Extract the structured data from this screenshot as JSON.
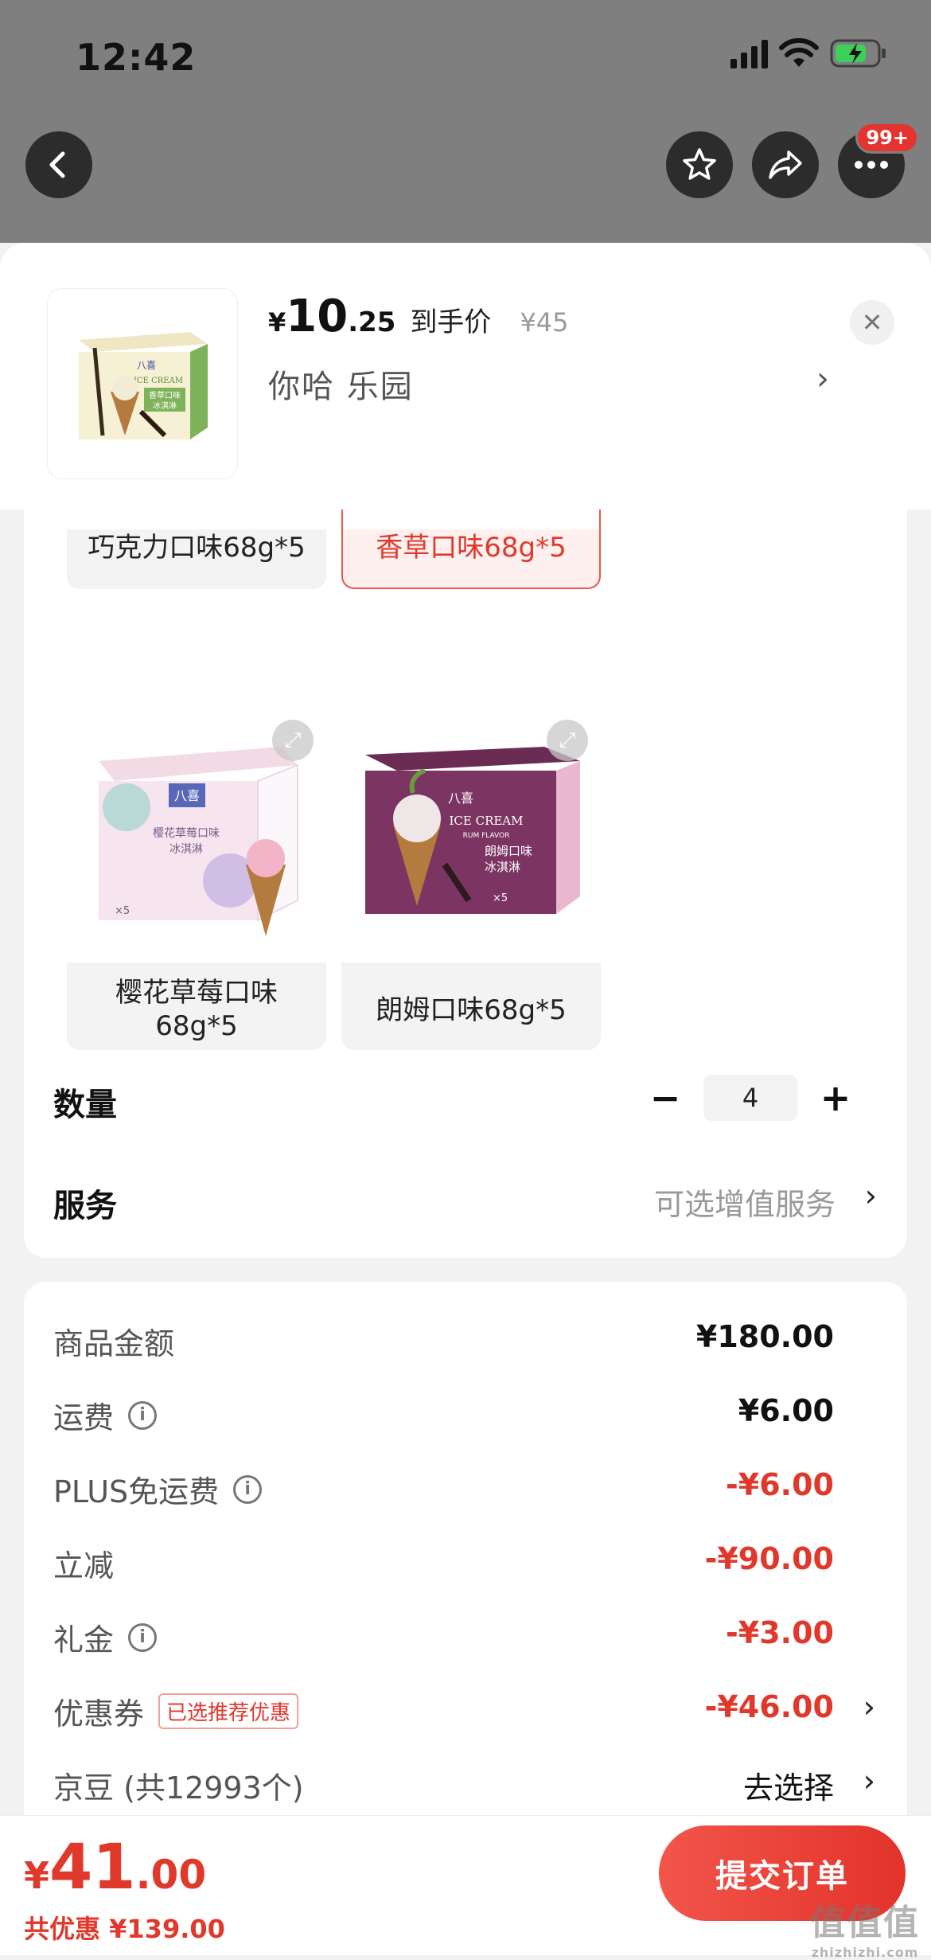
{
  "status_bar": {
    "time": "12:42"
  },
  "nav": {
    "more_badge": "99+"
  },
  "header": {
    "price_symbol": "¥",
    "price_int": "10",
    "price_dec": ".25",
    "price_label": "到手价",
    "original_price": "¥45",
    "selected_spec": "你哈  乐园",
    "spec_chevron": "›",
    "close_symbol": "✕"
  },
  "variants": [
    {
      "label": "巧克力口味68g*5"
    },
    {
      "label": "香草口味68g*5",
      "selected": true
    },
    {
      "label": "樱花草莓口味68g*5",
      "label_line1": "樱花草莓口味",
      "label_line2": "68g*5"
    },
    {
      "label": "朗姆口味68g*5"
    }
  ],
  "product_box": {
    "brand": "八喜",
    "ice_cream": "ICE CREAM",
    "vanilla_flavor": "香草口味",
    "strawberry_flavor": "樱花草莓口味",
    "rum_flavor": "朗姆口味",
    "rum_sub": "RUM FLAVOR",
    "ice_cream_cn": "冰淇淋",
    "pack": "×5"
  },
  "quantity": {
    "label": "数量",
    "minus": "−",
    "value": "4",
    "plus": "+"
  },
  "service": {
    "label": "服务",
    "value": "可选增值服务",
    "chevron": "›"
  },
  "price_breakdown": [
    {
      "label": "商品金额",
      "value": "¥180.00",
      "info": false,
      "red": false
    },
    {
      "label": "运费",
      "value": "¥6.00",
      "info": true,
      "red": false
    },
    {
      "label": "PLUS免运费",
      "value": "-¥6.00",
      "info": true,
      "red": true
    },
    {
      "label": "立减",
      "value": "-¥90.00",
      "info": false,
      "red": true
    },
    {
      "label": "礼金",
      "value": "-¥3.00",
      "info": true,
      "red": true
    },
    {
      "label": "优惠券",
      "tag": "已选推荐优惠",
      "value": "-¥46.00",
      "info": false,
      "red": true,
      "chevron": "›"
    },
    {
      "label": "京豆 (共12993个)",
      "value": "去选择",
      "info": false,
      "red": false,
      "chevron": "›"
    }
  ],
  "info_icon_text": "i",
  "footer": {
    "total_symbol": "¥",
    "total_int": "41",
    "total_dec": ".00",
    "saved": "共优惠 ¥139.00",
    "submit": "提交订单"
  },
  "watermark": {
    "line1": "值值值",
    "line2": "zhizhizhi.com"
  },
  "colors": {
    "accent_red": "#e0392c",
    "overlay_gray": "#7f7f7f"
  }
}
